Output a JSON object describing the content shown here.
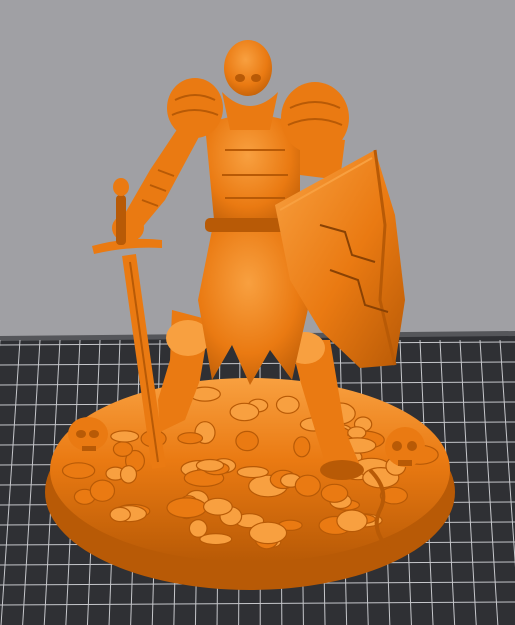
{
  "viewport": {
    "background_color": "#a0a0a4",
    "bed_color": "#2f3034",
    "grid_color": "#c6c7cb",
    "bed_edge_color": "#55565a"
  },
  "model": {
    "color": "#ea7a12",
    "shadow_color": "#b85a06",
    "highlight_color": "#f8a040",
    "subject": "skeleton-knight-miniature-with-sword-and-shield"
  }
}
